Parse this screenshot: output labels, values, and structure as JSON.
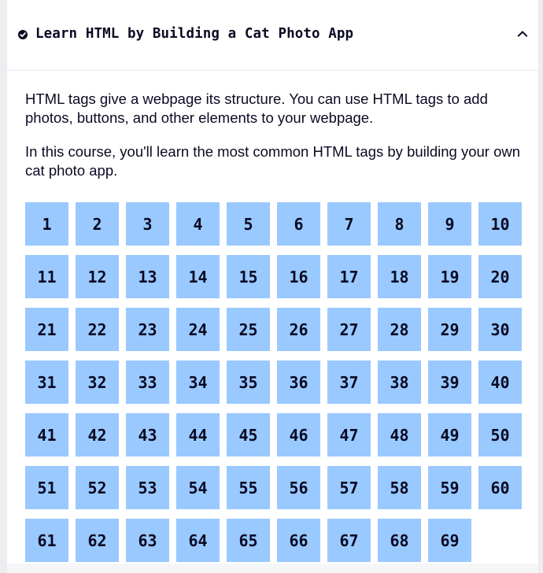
{
  "block": {
    "title": "Learn HTML by Building a Cat Photo App",
    "status_icon": "check-circle-icon",
    "toggle_icon": "chevron-up-icon",
    "expanded": true
  },
  "description": [
    "HTML tags give a webpage its structure. You can use HTML tags to add photos, buttons, and other elements to your webpage.",
    "In this course, you'll learn the most common HTML tags by building your own cat photo app."
  ],
  "steps": [
    "1",
    "2",
    "3",
    "4",
    "5",
    "6",
    "7",
    "8",
    "9",
    "10",
    "11",
    "12",
    "13",
    "14",
    "15",
    "16",
    "17",
    "18",
    "19",
    "20",
    "21",
    "22",
    "23",
    "24",
    "25",
    "26",
    "27",
    "28",
    "29",
    "30",
    "31",
    "32",
    "33",
    "34",
    "35",
    "36",
    "37",
    "38",
    "39",
    "40",
    "41",
    "42",
    "43",
    "44",
    "45",
    "46",
    "47",
    "48",
    "49",
    "50",
    "51",
    "52",
    "53",
    "54",
    "55",
    "56",
    "57",
    "58",
    "59",
    "60",
    "61",
    "62",
    "63",
    "64",
    "65",
    "66",
    "67",
    "68",
    "69"
  ],
  "colors": {
    "step_background": "#99c9ff",
    "text": "#0a0a23",
    "card_background": "#ffffff",
    "page_background": "#ecedf0"
  }
}
